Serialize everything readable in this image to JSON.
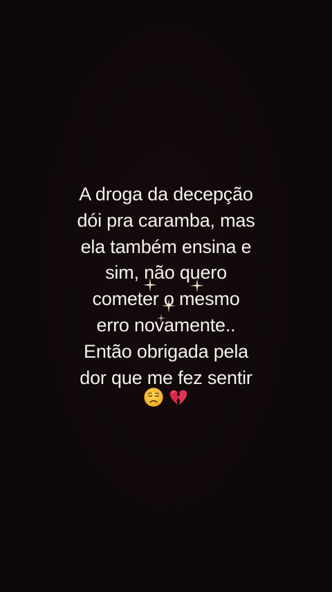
{
  "story": {
    "lines": [
      "A droga da decepção",
      "dói pra caramba, mas",
      "ela também ensina e",
      "sim, não quero",
      "cometer o mesmo",
      "erro novamente..",
      "Então obrigada pela",
      "dor que me fez sentir"
    ],
    "emojis": [
      "disappointed-face-icon",
      "broken-heart-icon"
    ]
  },
  "colors": {
    "background": "#0d0708",
    "text": "#f4f1ee",
    "emoji_face": "#f7c53a",
    "emoji_heart": "#d8284a"
  }
}
